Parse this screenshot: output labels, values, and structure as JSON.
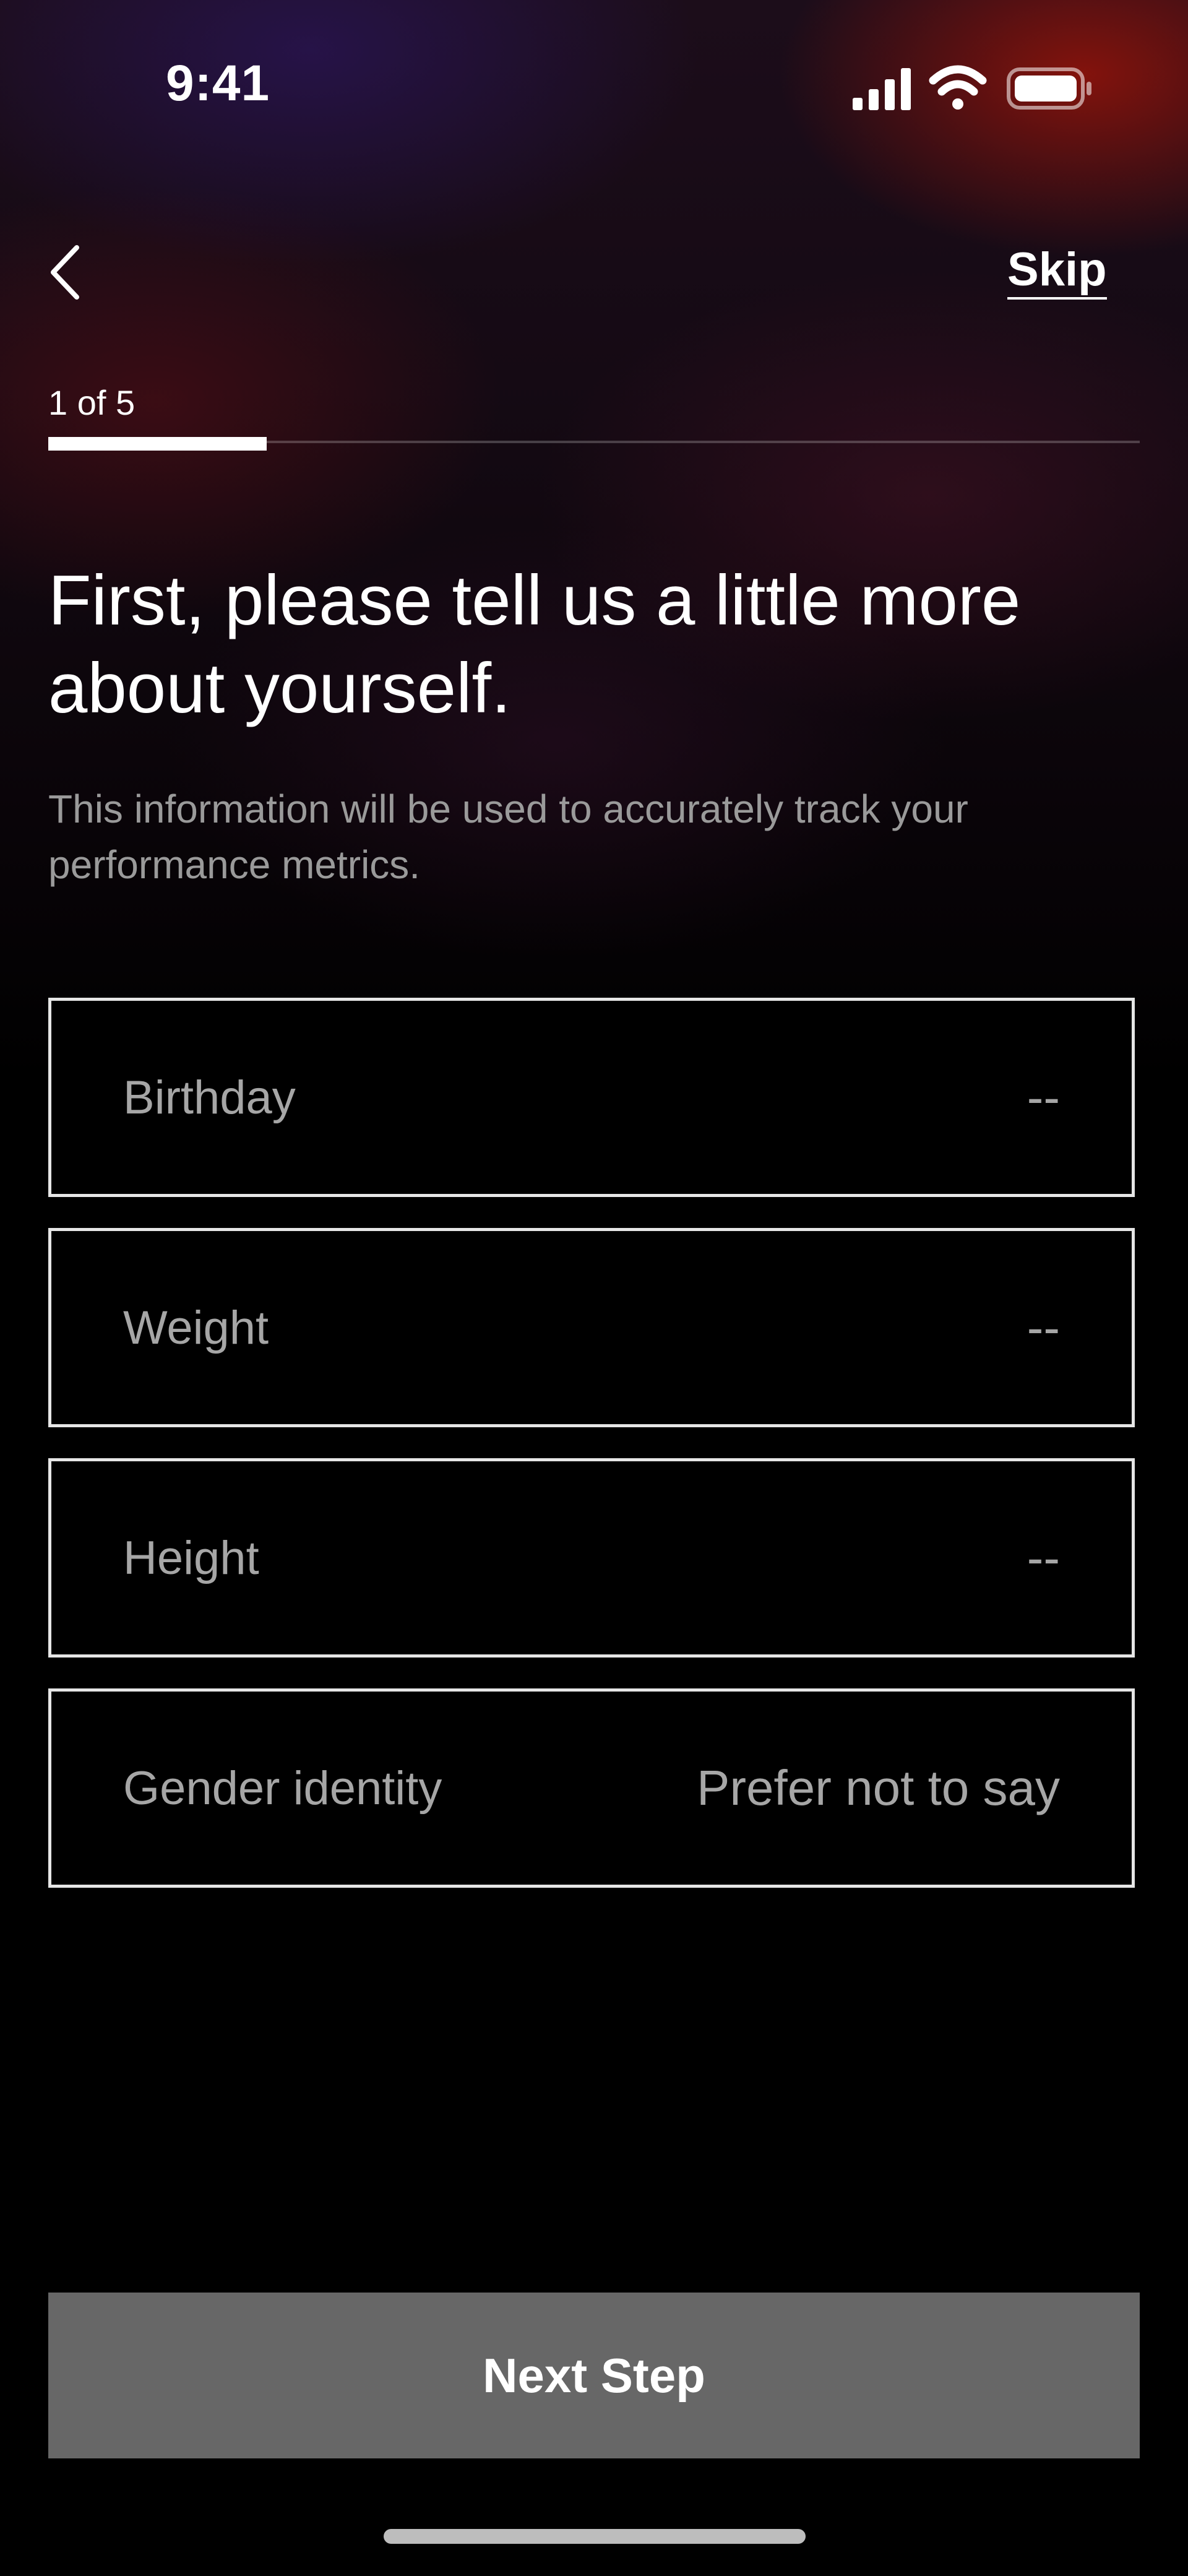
{
  "status_bar": {
    "time": "9:41",
    "icons": [
      "cellular-signal-icon",
      "wifi-icon",
      "battery-icon"
    ]
  },
  "nav": {
    "back_icon": "chevron-left-icon",
    "skip_label": "Skip"
  },
  "progress": {
    "label": "1 of 5",
    "current_step": 1,
    "total_steps": 5,
    "fraction": 0.2
  },
  "headline": "First, please tell us a little more about yourself.",
  "subtext": "This information will be used to accurately track your performance metrics.",
  "fields": [
    {
      "label": "Birthday",
      "value": "--"
    },
    {
      "label": "Weight",
      "value": "--"
    },
    {
      "label": "Height",
      "value": "--"
    },
    {
      "label": "Gender identity",
      "value": "Prefer not to say"
    }
  ],
  "next_button_label": "Next Step",
  "colors": {
    "background": "#000000",
    "button_disabled": "#676767",
    "field_border": "#e6e6e6",
    "muted_text": "#a6a6a6"
  }
}
